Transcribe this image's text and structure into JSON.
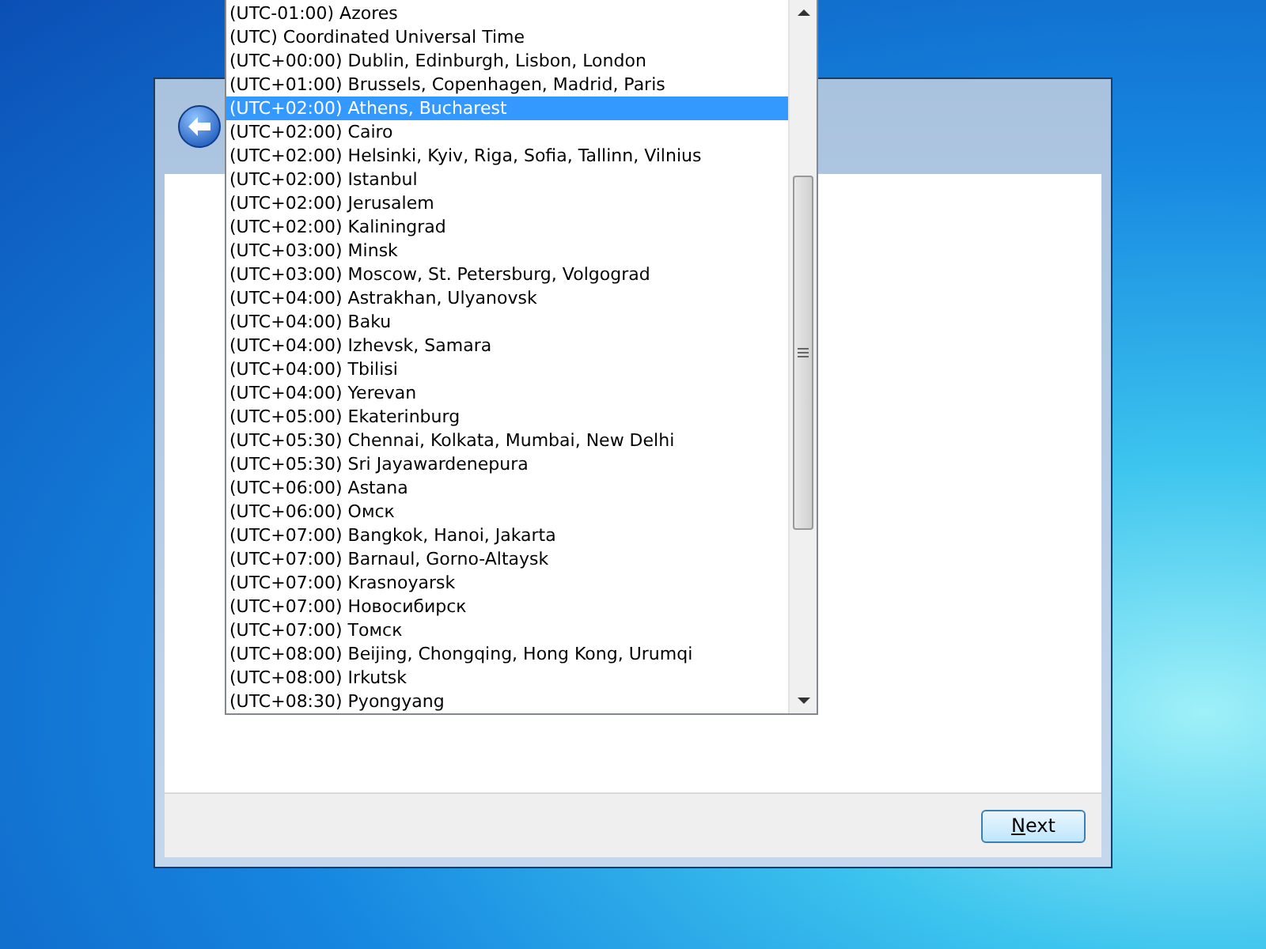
{
  "timezone_list": [
    {
      "label": "(UTC-01:00) Azores",
      "selected": false
    },
    {
      "label": "(UTC) Coordinated Universal Time",
      "selected": false
    },
    {
      "label": "(UTC+00:00) Dublin, Edinburgh, Lisbon, London",
      "selected": false
    },
    {
      "label": "(UTC+01:00) Brussels, Copenhagen, Madrid, Paris",
      "selected": false
    },
    {
      "label": "(UTC+02:00) Athens, Bucharest",
      "selected": true
    },
    {
      "label": "(UTC+02:00) Cairo",
      "selected": false
    },
    {
      "label": "(UTC+02:00) Helsinki, Kyiv, Riga, Sofia, Tallinn, Vilnius",
      "selected": false
    },
    {
      "label": "(UTC+02:00) Istanbul",
      "selected": false
    },
    {
      "label": "(UTC+02:00) Jerusalem",
      "selected": false
    },
    {
      "label": "(UTC+02:00) Kaliningrad",
      "selected": false
    },
    {
      "label": "(UTC+03:00) Minsk",
      "selected": false
    },
    {
      "label": "(UTC+03:00) Moscow, St. Petersburg, Volgograd",
      "selected": false
    },
    {
      "label": "(UTC+04:00) Astrakhan, Ulyanovsk",
      "selected": false
    },
    {
      "label": "(UTC+04:00) Baku",
      "selected": false
    },
    {
      "label": "(UTC+04:00) Izhevsk, Samara",
      "selected": false
    },
    {
      "label": "(UTC+04:00) Tbilisi",
      "selected": false
    },
    {
      "label": "(UTC+04:00) Yerevan",
      "selected": false
    },
    {
      "label": "(UTC+05:00) Ekaterinburg",
      "selected": false
    },
    {
      "label": "(UTC+05:30) Chennai, Kolkata, Mumbai, New Delhi",
      "selected": false
    },
    {
      "label": "(UTC+05:30) Sri Jayawardenepura",
      "selected": false
    },
    {
      "label": "(UTC+06:00) Astana",
      "selected": false
    },
    {
      "label": "(UTC+06:00) Омск",
      "selected": false
    },
    {
      "label": "(UTC+07:00) Bangkok, Hanoi, Jakarta",
      "selected": false
    },
    {
      "label": "(UTC+07:00) Barnaul, Gorno-Altaysk",
      "selected": false
    },
    {
      "label": "(UTC+07:00) Krasnoyarsk",
      "selected": false
    },
    {
      "label": "(UTC+07:00) Новосибирск",
      "selected": false
    },
    {
      "label": "(UTC+07:00) Томск",
      "selected": false
    },
    {
      "label": "(UTC+08:00) Beijing, Chongqing, Hong Kong, Urumqi",
      "selected": false
    },
    {
      "label": "(UTC+08:00) Irkutsk",
      "selected": false
    },
    {
      "label": "(UTC+08:30) Pyongyang",
      "selected": false
    }
  ],
  "buttons": {
    "next": "Next"
  }
}
